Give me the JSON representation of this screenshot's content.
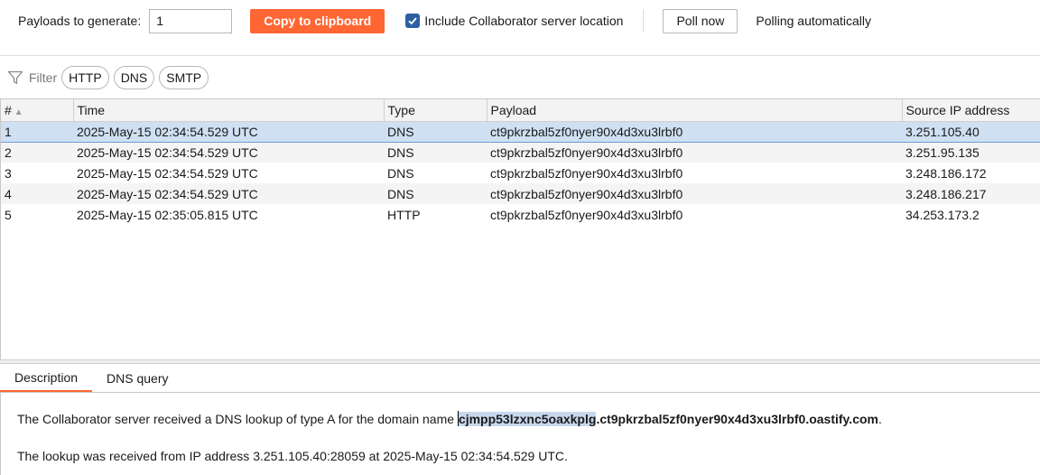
{
  "toolbar": {
    "payloads_label": "Payloads to generate:",
    "payloads_value": "1",
    "copy_button": "Copy to clipboard",
    "include_label": "Include Collaborator server location",
    "include_checked": true,
    "poll_button": "Poll now",
    "poll_status": "Polling automatically"
  },
  "filter": {
    "label": "Filter",
    "chips": [
      "HTTP",
      "DNS",
      "SMTP"
    ]
  },
  "table": {
    "columns": [
      "#",
      "Time",
      "Type",
      "Payload",
      "Source IP address"
    ],
    "rows": [
      [
        "1",
        "2025-May-15 02:34:54.529 UTC",
        "DNS",
        "ct9pkrzbal5zf0nyer90x4d3xu3lrbf0",
        "3.251.105.40"
      ],
      [
        "2",
        "2025-May-15 02:34:54.529 UTC",
        "DNS",
        "ct9pkrzbal5zf0nyer90x4d3xu3lrbf0",
        "3.251.95.135"
      ],
      [
        "3",
        "2025-May-15 02:34:54.529 UTC",
        "DNS",
        "ct9pkrzbal5zf0nyer90x4d3xu3lrbf0",
        "3.248.186.172"
      ],
      [
        "4",
        "2025-May-15 02:34:54.529 UTC",
        "DNS",
        "ct9pkrzbal5zf0nyer90x4d3xu3lrbf0",
        "3.248.186.217"
      ],
      [
        "5",
        "2025-May-15 02:35:05.815 UTC",
        "HTTP",
        "ct9pkrzbal5zf0nyer90x4d3xu3lrbf0",
        "34.253.173.2"
      ]
    ],
    "selected_row": 0
  },
  "detail": {
    "tabs": [
      "Description",
      "DNS query"
    ],
    "active_tab": 0,
    "line1_prefix": "The Collaborator server received a DNS lookup of type A for the domain name ",
    "domain_highlight": "cjmpp53lzxnc5oaxkplg",
    "domain_rest": ".ct9pkrzbal5zf0nyer90x4d3xu3lrbf0.oastify.com",
    "line1_suffix": ".",
    "line2": "The lookup was received from IP address 3.251.105.40:28059 at 2025-May-15 02:34:54.529 UTC."
  },
  "colors": {
    "accent": "#ff6633",
    "checkbox": "#2e5fa3",
    "selection": "#cfe0f3"
  }
}
